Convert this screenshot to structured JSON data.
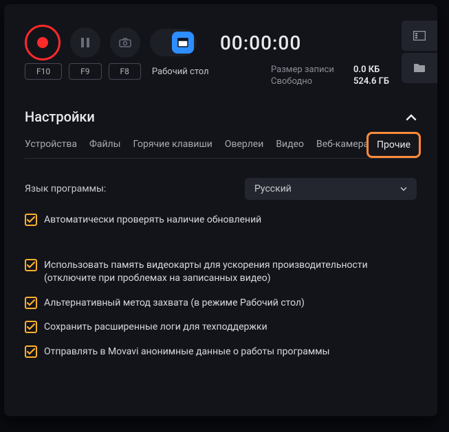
{
  "timer": "00:00:00",
  "stats": {
    "size_label": "Размер записи",
    "size_value": "0.0 КБ",
    "free_label": "Свободно",
    "free_value": "524.6 ГБ"
  },
  "hotkeys": [
    "F10",
    "F9",
    "F8"
  ],
  "mode_label": "Рабочий стол",
  "section_title": "Настройки",
  "tabs": [
    "Устройства",
    "Файлы",
    "Горячие клавиши",
    "Оверлеи",
    "Видео",
    "Веб-камера"
  ],
  "active_tab": "Прочие",
  "language": {
    "label": "Язык программы:",
    "value": "Русский"
  },
  "checks": [
    "Автоматически проверять наличие обновлений",
    "Использовать память видеокарты для ускорения производительности (отключите при проблемах на записанных видео)",
    "Альтернативный метод захвата (в режиме Рабочий стол)",
    "Сохранить расширенные логи для техподдержки",
    "Отправлять в Movavi анонимные данные о работы программы"
  ]
}
